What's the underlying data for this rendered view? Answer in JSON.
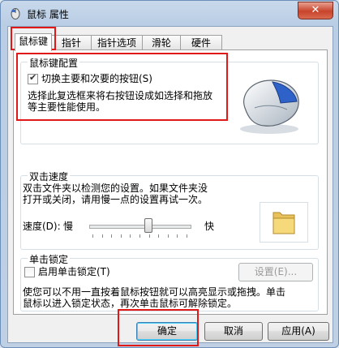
{
  "window": {
    "title": "鼠标 属性",
    "close_glyph": "✕",
    "icon": "mouse-app-icon"
  },
  "tabs": [
    {
      "label": "鼠标键",
      "active": true
    },
    {
      "label": "指针",
      "active": false
    },
    {
      "label": "指针选项",
      "active": false
    },
    {
      "label": "滑轮",
      "active": false
    },
    {
      "label": "硬件",
      "active": false
    }
  ],
  "button_config": {
    "title": "鼠标键配置",
    "swap_checkbox": {
      "label": "切换主要和次要的按钮(S)",
      "checked": true
    },
    "description_line1": "选择此复选框来将右按钮设成如选择和拖放",
    "description_line2": "等主要性能使用。",
    "image_icon": "mouse-illustration"
  },
  "double_click": {
    "title": "双击速度",
    "description_line1": "双击文件夹以检测您的设置。如果文件夹没",
    "description_line2": "打开或关闭，请用慢一点的设置再试一次。",
    "speed_label": "速度(D):",
    "slow_label": "慢",
    "fast_label": "快",
    "speed_level": 0.6,
    "test_icon": "folder-icon"
  },
  "click_lock": {
    "title": "单击锁定",
    "checkbox": {
      "label": "启用单击锁定(T)",
      "checked": false
    },
    "settings_button": "设置(E)...",
    "description_line1": "使您可以不用一直按着鼠标按钮就可以高亮显示或拖拽。单击",
    "description_line2": "鼠标以进入锁定状态，再次单击鼠标可解除锁定。"
  },
  "footer": {
    "ok": "确定",
    "cancel": "取消",
    "apply": "应用(A)"
  },
  "colors": {
    "annotation_red": "#e01818",
    "title_bar": "#c9d9ec"
  }
}
